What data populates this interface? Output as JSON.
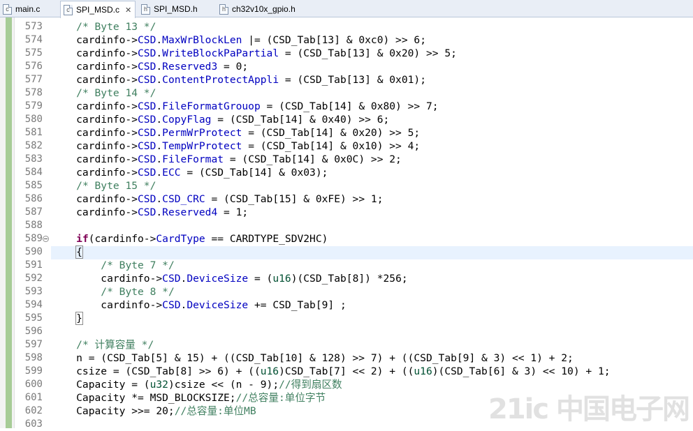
{
  "tabs": [
    {
      "label": "main.c",
      "icon": "c-file-icon",
      "active": false
    },
    {
      "label": "SPI_MSD.c",
      "icon": "c-file-icon",
      "active": true,
      "closable": true
    },
    {
      "label": "SPI_MSD.h",
      "icon": "h-file-icon",
      "active": false
    },
    {
      "label": "ch32v10x_gpio.h",
      "icon": "h-file-icon",
      "active": false
    }
  ],
  "colors": {
    "comment": "#3f7f5f",
    "field": "#0000c0",
    "keyword": "#7f0055",
    "line_number": "#7a7a7a",
    "current_line": "#e8f2fe",
    "change_bar": "#a7cc97"
  },
  "current_line": 590,
  "lines": [
    {
      "n": "573",
      "tokens": [
        [
          "    ",
          ""
        ],
        [
          "/* Byte 13 */",
          "cm"
        ]
      ]
    },
    {
      "n": "574",
      "tokens": [
        [
          "    cardinfo->",
          ""
        ],
        [
          "CSD",
          "fld"
        ],
        [
          ".",
          ""
        ],
        [
          "MaxWrBlockLen",
          "fld"
        ],
        [
          " |= (CSD_Tab[13] & 0xc0) >> 6;",
          ""
        ]
      ]
    },
    {
      "n": "575",
      "tokens": [
        [
          "    cardinfo->",
          ""
        ],
        [
          "CSD",
          "fld"
        ],
        [
          ".",
          ""
        ],
        [
          "WriteBlockPaPartial",
          "fld"
        ],
        [
          " = (CSD_Tab[13] & 0x20) >> 5;",
          ""
        ]
      ]
    },
    {
      "n": "576",
      "tokens": [
        [
          "    cardinfo->",
          ""
        ],
        [
          "CSD",
          "fld"
        ],
        [
          ".",
          ""
        ],
        [
          "Reserved3",
          "fld"
        ],
        [
          " = 0;",
          ""
        ]
      ]
    },
    {
      "n": "577",
      "tokens": [
        [
          "    cardinfo->",
          ""
        ],
        [
          "CSD",
          "fld"
        ],
        [
          ".",
          ""
        ],
        [
          "ContentProtectAppli",
          "fld"
        ],
        [
          " = (CSD_Tab[13] & 0x01);",
          ""
        ]
      ]
    },
    {
      "n": "578",
      "tokens": [
        [
          "    ",
          ""
        ],
        [
          "/* Byte 14 */",
          "cm"
        ]
      ]
    },
    {
      "n": "579",
      "tokens": [
        [
          "    cardinfo->",
          ""
        ],
        [
          "CSD",
          "fld"
        ],
        [
          ".",
          ""
        ],
        [
          "FileFormatGrouop",
          "fld"
        ],
        [
          " = (CSD_Tab[14] & 0x80) >> 7;",
          ""
        ]
      ]
    },
    {
      "n": "580",
      "tokens": [
        [
          "    cardinfo->",
          ""
        ],
        [
          "CSD",
          "fld"
        ],
        [
          ".",
          ""
        ],
        [
          "CopyFlag",
          "fld"
        ],
        [
          " = (CSD_Tab[14] & 0x40) >> 6;",
          ""
        ]
      ]
    },
    {
      "n": "581",
      "tokens": [
        [
          "    cardinfo->",
          ""
        ],
        [
          "CSD",
          "fld"
        ],
        [
          ".",
          ""
        ],
        [
          "PermWrProtect",
          "fld"
        ],
        [
          " = (CSD_Tab[14] & 0x20) >> 5;",
          ""
        ]
      ]
    },
    {
      "n": "582",
      "tokens": [
        [
          "    cardinfo->",
          ""
        ],
        [
          "CSD",
          "fld"
        ],
        [
          ".",
          ""
        ],
        [
          "TempWrProtect",
          "fld"
        ],
        [
          " = (CSD_Tab[14] & 0x10) >> 4;",
          ""
        ]
      ]
    },
    {
      "n": "583",
      "tokens": [
        [
          "    cardinfo->",
          ""
        ],
        [
          "CSD",
          "fld"
        ],
        [
          ".",
          ""
        ],
        [
          "FileFormat",
          "fld"
        ],
        [
          " = (CSD_Tab[14] & 0x0C) >> 2;",
          ""
        ]
      ]
    },
    {
      "n": "584",
      "tokens": [
        [
          "    cardinfo->",
          ""
        ],
        [
          "CSD",
          "fld"
        ],
        [
          ".",
          ""
        ],
        [
          "ECC",
          "fld"
        ],
        [
          " = (CSD_Tab[14] & 0x03);",
          ""
        ]
      ]
    },
    {
      "n": "585",
      "tokens": [
        [
          "    ",
          ""
        ],
        [
          "/* Byte 15 */",
          "cm"
        ]
      ]
    },
    {
      "n": "586",
      "tokens": [
        [
          "    cardinfo->",
          ""
        ],
        [
          "CSD",
          "fld"
        ],
        [
          ".",
          ""
        ],
        [
          "CSD_CRC",
          "fld"
        ],
        [
          " = (CSD_Tab[15] & 0xFE) >> 1;",
          ""
        ]
      ]
    },
    {
      "n": "587",
      "tokens": [
        [
          "    cardinfo->",
          ""
        ],
        [
          "CSD",
          "fld"
        ],
        [
          ".",
          ""
        ],
        [
          "Reserved4",
          "fld"
        ],
        [
          " = 1;",
          ""
        ]
      ]
    },
    {
      "n": "588",
      "tokens": []
    },
    {
      "n": "589",
      "fold": true,
      "tokens": [
        [
          "    ",
          ""
        ],
        [
          "if",
          "kw"
        ],
        [
          "(cardinfo->",
          ""
        ],
        [
          "CardType",
          "fld"
        ],
        [
          " == CARDTYPE_SDV2HC)",
          ""
        ]
      ]
    },
    {
      "n": "590",
      "tokens": [
        [
          "    ",
          ""
        ],
        [
          "{",
          "brace"
        ]
      ]
    },
    {
      "n": "591",
      "tokens": [
        [
          "        ",
          ""
        ],
        [
          "/* Byte 7 */",
          "cm"
        ]
      ]
    },
    {
      "n": "592",
      "tokens": [
        [
          "        cardinfo->",
          ""
        ],
        [
          "CSD",
          "fld"
        ],
        [
          ".",
          ""
        ],
        [
          "DeviceSize",
          "fld"
        ],
        [
          " = (",
          ""
        ],
        [
          "u16",
          "ty"
        ],
        [
          ")(CSD_Tab[8]) *256;",
          ""
        ]
      ]
    },
    {
      "n": "593",
      "tokens": [
        [
          "        ",
          ""
        ],
        [
          "/* Byte 8 */",
          "cm"
        ]
      ]
    },
    {
      "n": "594",
      "tokens": [
        [
          "        cardinfo->",
          ""
        ],
        [
          "CSD",
          "fld"
        ],
        [
          ".",
          ""
        ],
        [
          "DeviceSize",
          "fld"
        ],
        [
          " += CSD_Tab[9] ;",
          ""
        ]
      ]
    },
    {
      "n": "595",
      "tokens": [
        [
          "    ",
          ""
        ],
        [
          "}",
          "brace"
        ]
      ]
    },
    {
      "n": "596",
      "tokens": []
    },
    {
      "n": "597",
      "tokens": [
        [
          "    ",
          ""
        ],
        [
          "/* 计算容量 */",
          "cm"
        ]
      ]
    },
    {
      "n": "598",
      "tokens": [
        [
          "    n = (CSD_Tab[5] & 15) + ((CSD_Tab[10] & 128) >> 7) + ((CSD_Tab[9] & 3) << 1) + 2;",
          ""
        ]
      ]
    },
    {
      "n": "599",
      "tokens": [
        [
          "    csize = (CSD_Tab[8] >> 6) + ((",
          ""
        ],
        [
          "u16",
          "ty"
        ],
        [
          ")CSD_Tab[7] << 2) + ((",
          ""
        ],
        [
          "u16",
          "ty"
        ],
        [
          ")(CSD_Tab[6] & 3) << 10) + 1;",
          ""
        ]
      ]
    },
    {
      "n": "600",
      "tokens": [
        [
          "    Capacity = (",
          ""
        ],
        [
          "u32",
          "ty"
        ],
        [
          ")csize << (n - 9);",
          ""
        ],
        [
          "//得到扇区数",
          "cm"
        ]
      ]
    },
    {
      "n": "601",
      "tokens": [
        [
          "    Capacity *= MSD_BLOCKSIZE;",
          ""
        ],
        [
          "//总容量:单位字节",
          "cm"
        ]
      ]
    },
    {
      "n": "602",
      "tokens": [
        [
          "    Capacity >>= 20;",
          ""
        ],
        [
          "//总容量:单位MB",
          "cm"
        ]
      ]
    },
    {
      "n": "603",
      "tokens": []
    }
  ],
  "watermark": "21ic 中国电子网"
}
